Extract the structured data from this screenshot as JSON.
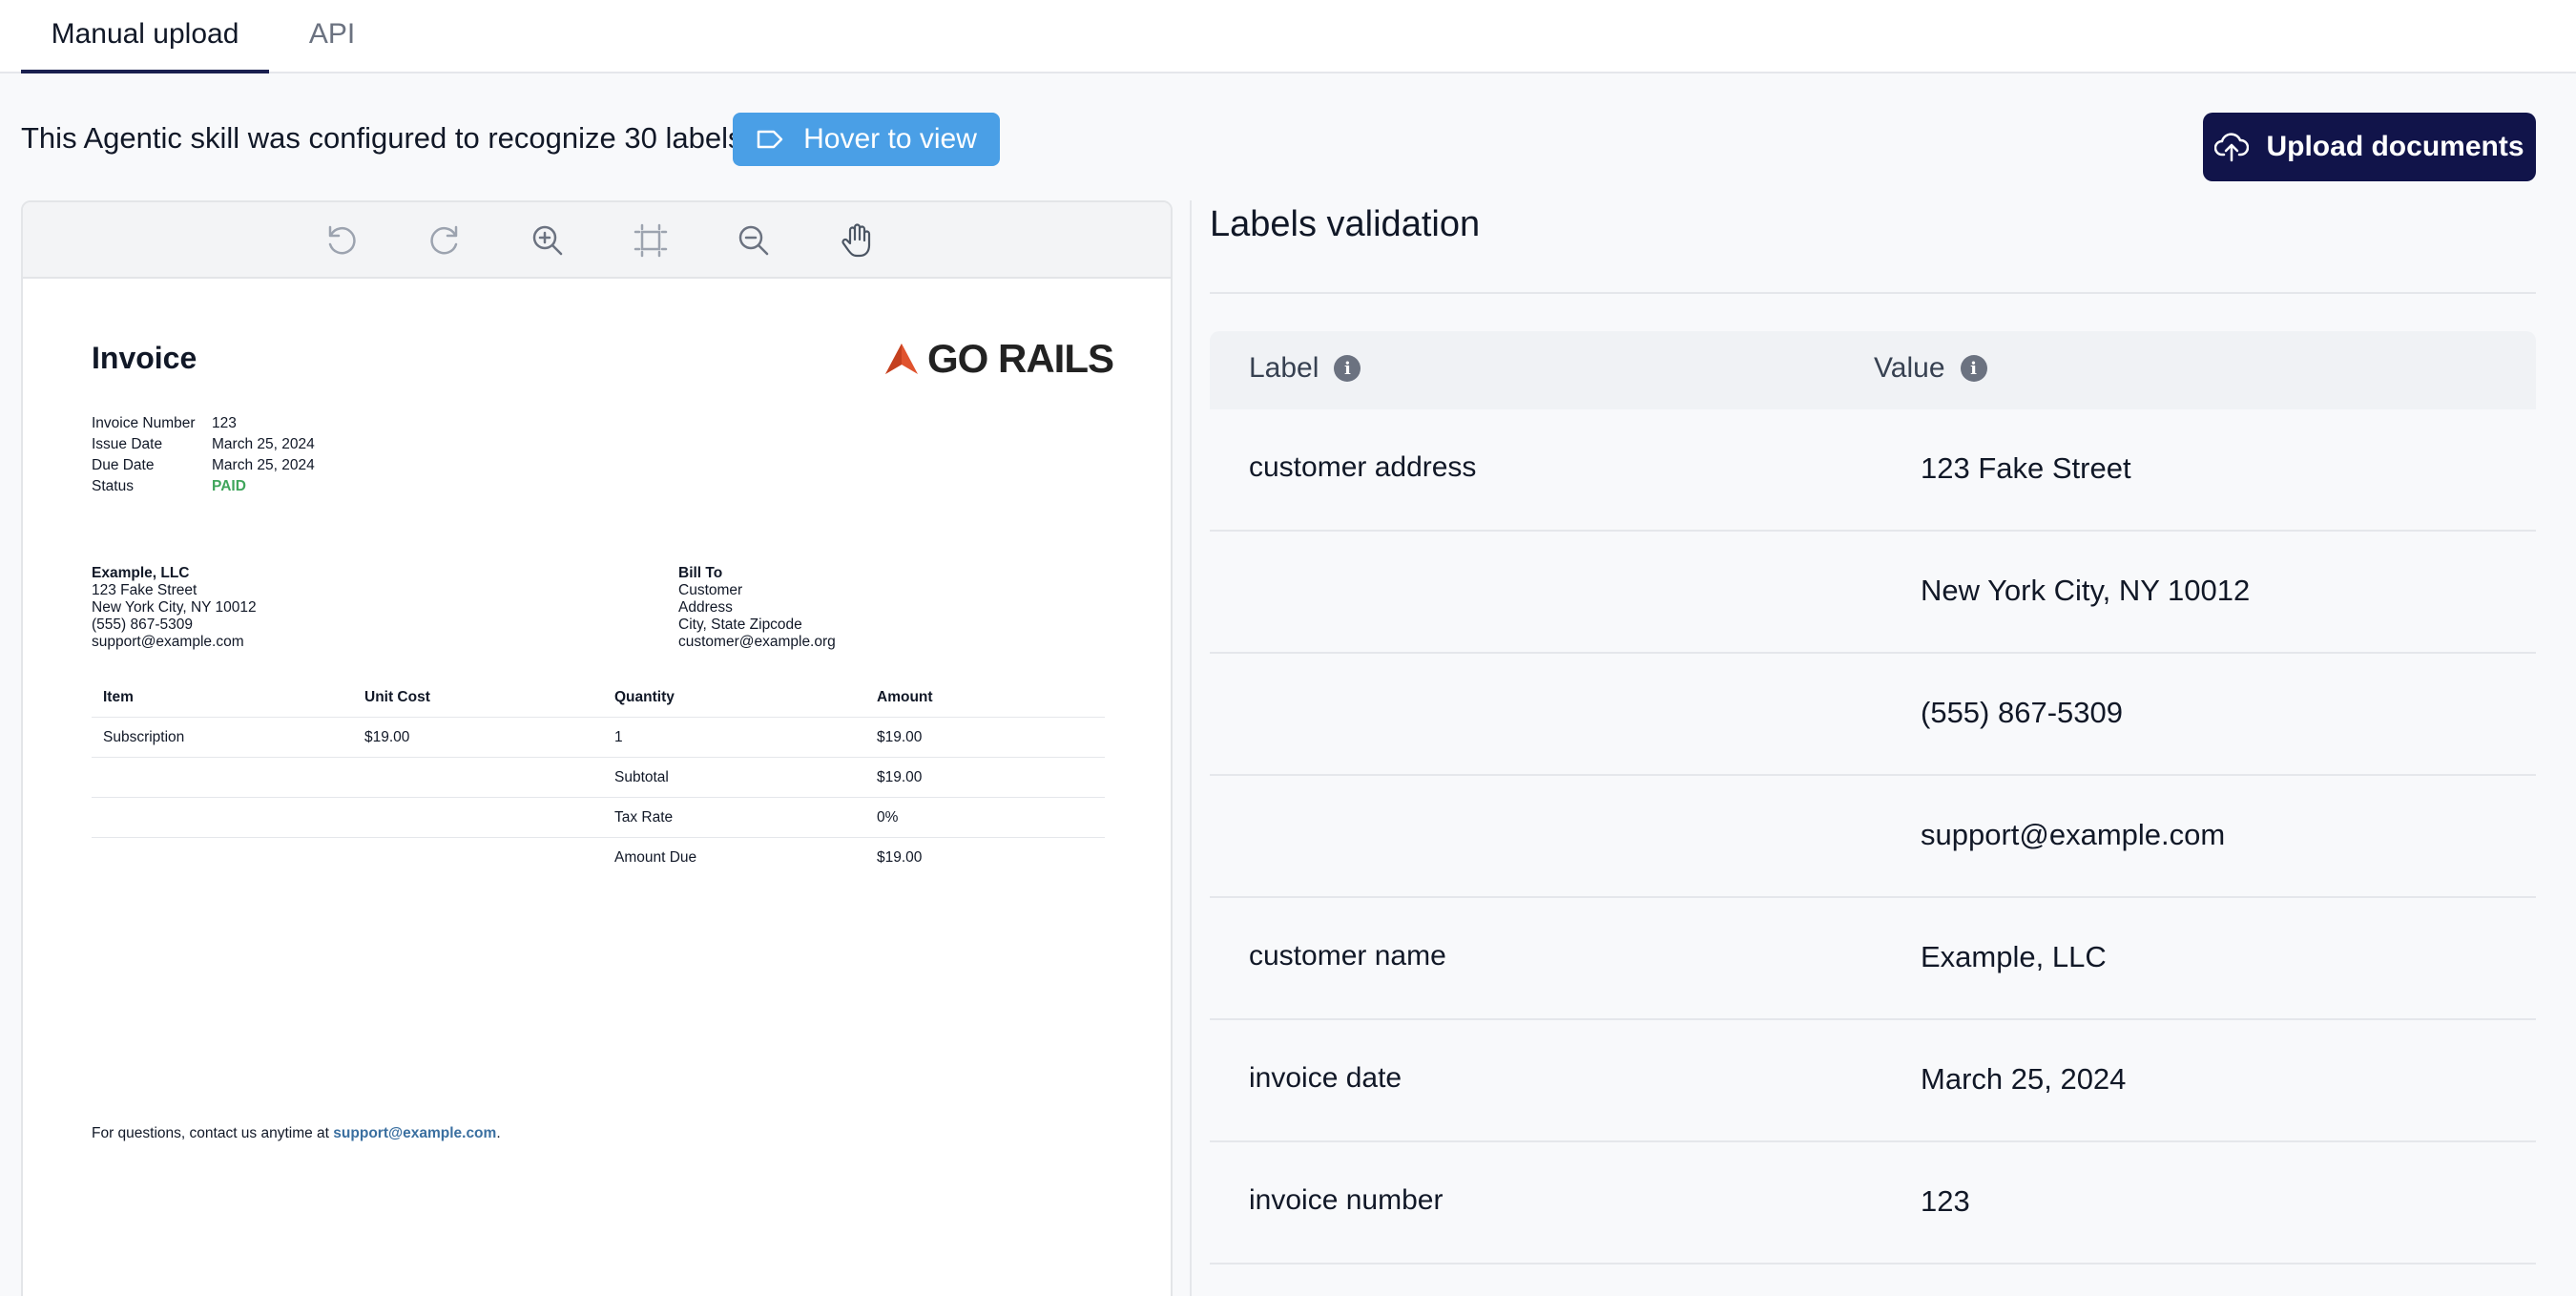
{
  "tabs": [
    {
      "label": "Manual upload",
      "active": true
    },
    {
      "label": "API",
      "active": false
    }
  ],
  "info": {
    "text": "This Agentic skill was configured to recognize 30 labels",
    "hover_button": "Hover to view"
  },
  "upload_button": "Upload documents",
  "toolbar_icons": [
    "rotate-left-icon",
    "rotate-right-icon",
    "zoom-in-icon",
    "fit-page-icon",
    "zoom-out-icon",
    "hand-pan-icon"
  ],
  "invoice": {
    "title": "Invoice",
    "logo": "GO RAILS",
    "meta": [
      {
        "key": "Invoice Number",
        "value": "123"
      },
      {
        "key": "Issue Date",
        "value": "March 25, 2024"
      },
      {
        "key": "Due Date",
        "value": "March 25, 2024"
      },
      {
        "key": "Status",
        "value": "PAID"
      }
    ],
    "from": {
      "name": "Example, LLC",
      "lines": [
        "123 Fake Street",
        "New York City, NY 10012",
        "(555) 867-5309",
        "support@example.com"
      ]
    },
    "bill_to": {
      "heading": "Bill To",
      "lines": [
        "Customer",
        "Address",
        "City, State Zipcode",
        "customer@example.org"
      ]
    },
    "table": {
      "headers": [
        "Item",
        "Unit Cost",
        "Quantity",
        "Amount"
      ],
      "rows": [
        [
          "Subscription",
          "$19.00",
          "1",
          "$19.00"
        ],
        [
          "",
          "",
          "Subtotal",
          "$19.00"
        ],
        [
          "",
          "",
          "Tax Rate",
          "0%"
        ],
        [
          "",
          "",
          "Amount Due",
          "$19.00"
        ]
      ]
    },
    "footnote_prefix": "For questions, contact us anytime at ",
    "footnote_link": "support@example.com",
    "footnote_suffix": "."
  },
  "labels_validation": {
    "title": "Labels validation",
    "headers": {
      "label": "Label",
      "value": "Value"
    },
    "rows": [
      {
        "label": "customer address",
        "value": "123 Fake Street"
      },
      {
        "label": "",
        "value": "New York City, NY 10012"
      },
      {
        "label": "",
        "value": "(555) 867-5309"
      },
      {
        "label": "",
        "value": "support@example.com"
      },
      {
        "label": "customer name",
        "value": "Example, LLC"
      },
      {
        "label": "invoice date",
        "value": "March 25, 2024"
      },
      {
        "label": "invoice number",
        "value": "123"
      }
    ]
  },
  "colors": {
    "accent_blue": "#4a9fe6",
    "navy": "#11144a",
    "paid_green": "#3fa55b"
  }
}
